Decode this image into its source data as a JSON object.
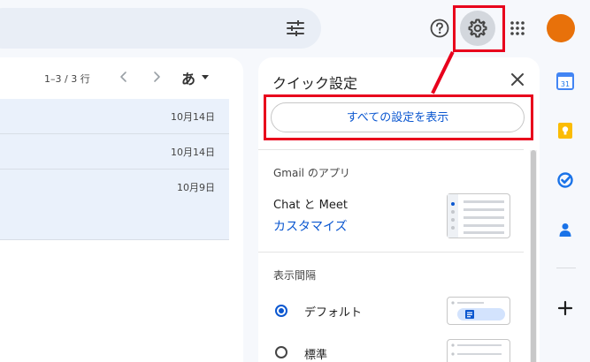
{
  "header": {
    "icons": [
      "tune-icon",
      "help-icon",
      "gear-icon",
      "apps-icon"
    ],
    "avatar_color": "#e8710a"
  },
  "list": {
    "pager_text": "1–3 / 3 行",
    "lang_label": "あ",
    "dates": [
      "10月14日",
      "10月14日",
      "10月9日"
    ]
  },
  "quick_settings": {
    "title": "クイック設定",
    "all_settings_label": "すべての設定を表示",
    "apps_section_title": "Gmail のアプリ",
    "chat_meet_label": "Chat と Meet",
    "customize_label": "カスタマイズ",
    "density_section_title": "表示間隔",
    "density_options": [
      {
        "label": "デフォルト",
        "selected": true
      },
      {
        "label": "標準",
        "selected": false
      }
    ]
  },
  "colors": {
    "accent": "#0b57d0",
    "highlight": "#e8001c",
    "background": "#f6f8fc"
  },
  "side_rail": {
    "icons": [
      "calendar-icon",
      "keep-icon",
      "tasks-icon",
      "contacts-icon",
      "plus-icon"
    ],
    "calendar_number": "31"
  }
}
